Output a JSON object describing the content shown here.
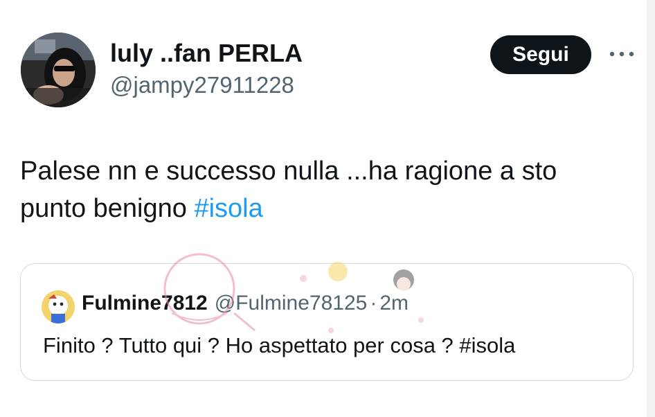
{
  "tweet": {
    "author": {
      "display_name": "luly ..fan PERLA",
      "handle": "@jampy27911228"
    },
    "follow_label": "Segui",
    "more_icon": "more-horizontal-icon",
    "text": "Palese nn e successo nulla ...ha ragione a sto punto benigno ",
    "hashtag": "#isola"
  },
  "quote": {
    "author": {
      "display_name": "Fulmine7812",
      "handle": "@Fulmine78125",
      "separator": "·",
      "time": "2m"
    },
    "text": "Finito ? Tutto qui ? Ho aspettato per cosa ? #isola"
  },
  "colors": {
    "link": "#1d9bf0",
    "text_primary": "#0f1419",
    "text_secondary": "#536471",
    "border": "#cfd9de",
    "follow_bg": "#0f1419"
  }
}
